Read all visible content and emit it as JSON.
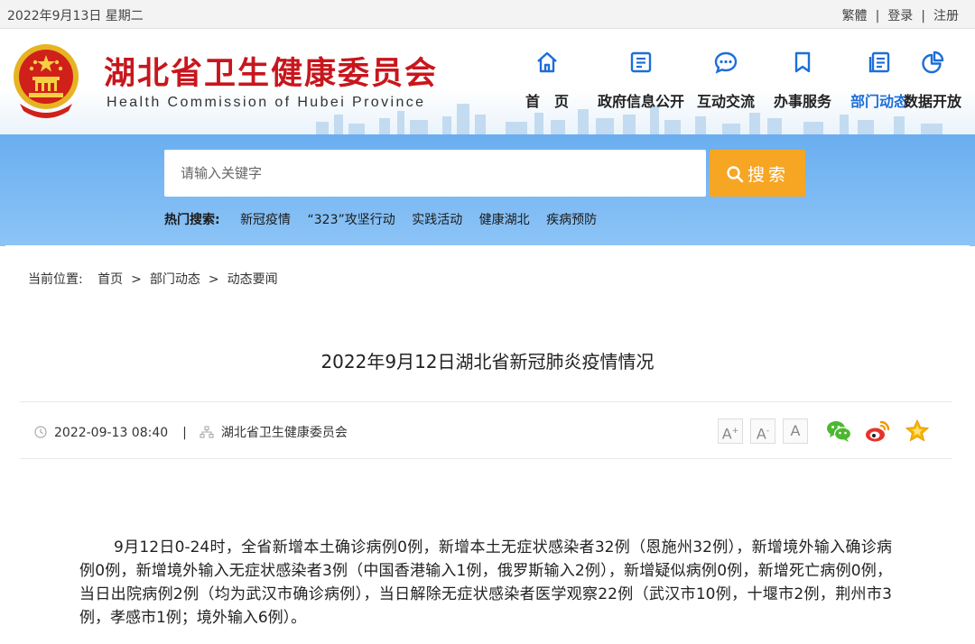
{
  "topbar": {
    "date": "2022年9月13日 星期二",
    "links": [
      "繁體",
      "登录",
      "注册"
    ],
    "separator": "|"
  },
  "header": {
    "title": "湖北省卫生健康委员会",
    "subtitle": "Health Commission of Hubei Province",
    "emblem_icon": "national-emblem"
  },
  "nav": {
    "items": [
      {
        "label": "首　页",
        "icon": "home-icon"
      },
      {
        "label": "政府信息公开",
        "icon": "document-icon"
      },
      {
        "label": "互动交流",
        "icon": "chat-icon"
      },
      {
        "label": "办事服务",
        "icon": "bookmark-icon"
      },
      {
        "label": "部门动态",
        "icon": "news-icon",
        "active": true
      },
      {
        "label": "数据开放",
        "icon": "pie-chart-icon"
      }
    ],
    "active_color": "#1d6ed8"
  },
  "search": {
    "placeholder": "请输入关键字",
    "button_label": "搜索",
    "button_color": "#f6a623",
    "hot_label": "热门搜索:",
    "hot_keywords": [
      "新冠疫情",
      "“323”攻坚行动",
      "实践活动",
      "健康湖北",
      "疾病预防"
    ]
  },
  "breadcrumb": {
    "label": "当前位置:",
    "items": [
      "首页",
      "部门动态",
      "动态要闻"
    ],
    "separator": ">"
  },
  "article": {
    "title": "2022年9月12日湖北省新冠肺炎疫情情况",
    "datetime": "2022-09-13 08:40",
    "meta_separator": "|",
    "source": "湖北省卫生健康委员会",
    "font_buttons": [
      "A+",
      "A",
      "A"
    ],
    "share_icons": [
      "wechat-icon",
      "weibo-icon",
      "favorite-star-icon"
    ],
    "body": "9月12日0-24时，全省新增本土确诊病例0例，新增本土无症状感染者32例（恩施州32例），新增境外输入确诊病例0例，新增境外输入无症状感染者3例（中国香港输入1例，俄罗斯输入2例），新增疑似病例0例，新增死亡病例0例，当日出院病例2例（均为武汉市确诊病例），当日解除无症状感染者医学观察22例（武汉市10例，十堰市2例，荆州市3例，孝感市1例；境外输入6例）。"
  }
}
